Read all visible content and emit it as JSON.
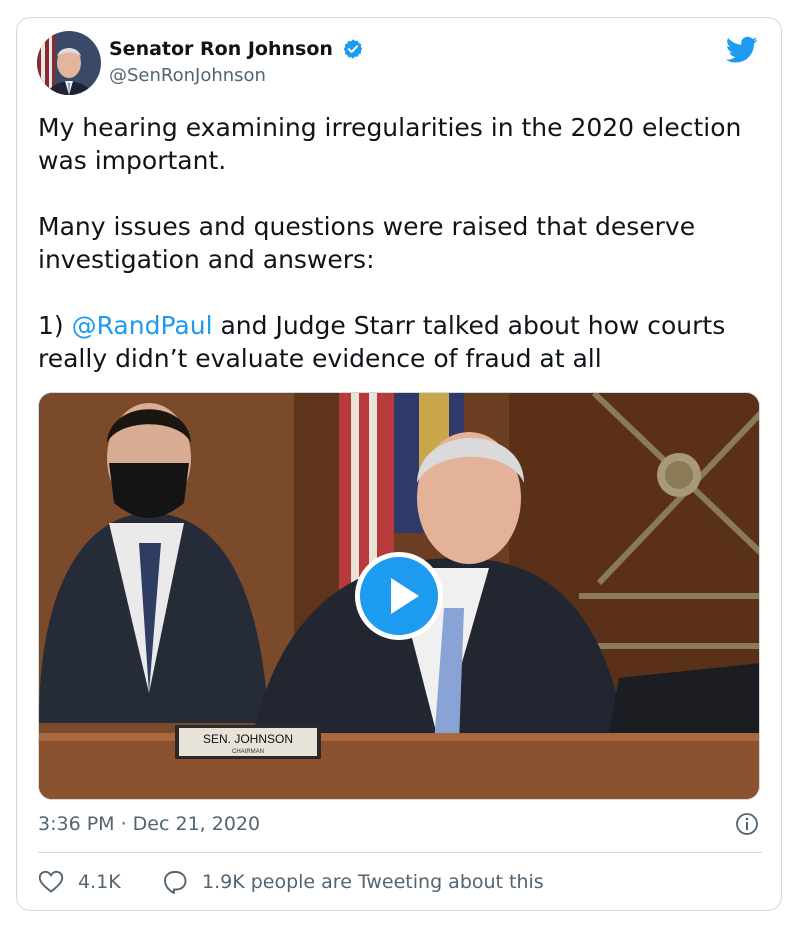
{
  "author": {
    "display_name": "Senator Ron Johnson",
    "handle": "@SenRonJohnson",
    "verified": true,
    "avatar": "senator-portrait"
  },
  "tweet": {
    "paragraph_1": "My hearing examining irregularities in the 2020 election was important.",
    "paragraph_2": "Many issues and questions were raised that deserve investigation and answers:",
    "paragraph_3_prefix": "1) ",
    "paragraph_3_mention": "@RandPaul",
    "paragraph_3_suffix": " and Judge Starr talked about how courts really didn’t evaluate evidence of fraud at all"
  },
  "media": {
    "type": "video",
    "nameplate_line1": "SEN. JOHNSON",
    "nameplate_line2": "CHAIRMAN"
  },
  "timestamp": "3:36 PM · Dec 21, 2020",
  "engagement": {
    "likes": "4.1K",
    "conversation": "1.9K people are Tweeting about this"
  },
  "colors": {
    "accent": "#1d9bf0",
    "text": "#0f1419",
    "secondary": "#536471",
    "border": "#cfd9de"
  },
  "icons": [
    "verified-badge-icon",
    "twitter-bird-icon",
    "play-icon",
    "info-icon",
    "heart-icon",
    "reply-icon"
  ]
}
